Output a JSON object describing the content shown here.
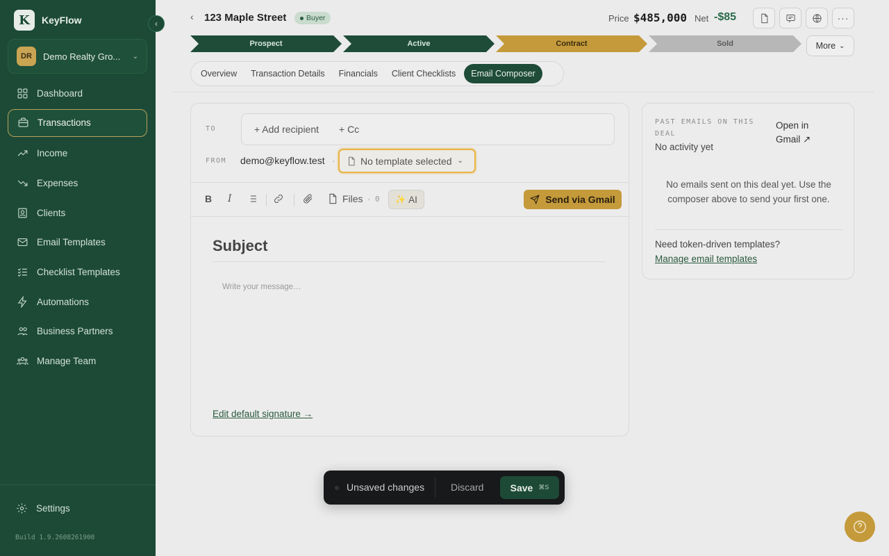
{
  "app": {
    "name": "KeyFlow",
    "logo_letter": "K"
  },
  "org": {
    "initials": "DR",
    "name": "Demo Realty Gro..."
  },
  "nav": {
    "items": [
      {
        "label": "Dashboard",
        "icon": "dashboard-icon"
      },
      {
        "label": "Transactions",
        "icon": "briefcase-icon",
        "active": true
      },
      {
        "label": "Income",
        "icon": "trend-up-icon"
      },
      {
        "label": "Expenses",
        "icon": "trend-down-icon"
      },
      {
        "label": "Clients",
        "icon": "contacts-icon"
      },
      {
        "label": "Email Templates",
        "icon": "mail-icon"
      },
      {
        "label": "Checklist Templates",
        "icon": "checklist-icon"
      },
      {
        "label": "Automations",
        "icon": "bolt-icon"
      },
      {
        "label": "Business Partners",
        "icon": "partners-icon"
      },
      {
        "label": "Manage Team",
        "icon": "team-icon"
      }
    ],
    "settings_label": "Settings",
    "build": "Build 1.9.2608261900"
  },
  "header": {
    "title": "123 Maple Street",
    "badge": "Buyer",
    "price_label": "Price",
    "price_value": "$485,000",
    "net_label": "Net",
    "net_value": "-$85"
  },
  "stages": {
    "items": [
      {
        "label": "Prospect",
        "state": "done"
      },
      {
        "label": "Active",
        "state": "done"
      },
      {
        "label": "Contract",
        "state": "current"
      },
      {
        "label": "Sold",
        "state": "pending"
      }
    ],
    "more_label": "More"
  },
  "tabs": [
    {
      "label": "Overview"
    },
    {
      "label": "Transaction Details"
    },
    {
      "label": "Financials"
    },
    {
      "label": "Client Checklists"
    },
    {
      "label": "Email Composer",
      "active": true
    }
  ],
  "composer": {
    "to_label": "TO",
    "add_recipient": "+ Add recipient",
    "add_cc": "+ Cc",
    "from_label": "FROM",
    "from_email": "demo@keyflow.test",
    "template_select": "No template selected",
    "toolbar": {
      "bold": "B",
      "italic": "I",
      "files_label": "Files",
      "files_count": "0",
      "ai_label": "AI",
      "send_label": "Send via Gmail"
    },
    "subject_placeholder": "Subject",
    "message_placeholder": "Write your message…",
    "signature_link": "Edit default signature →"
  },
  "past_emails": {
    "label": "PAST EMAILS ON THIS DEAL",
    "status": "No activity yet",
    "open_gmail": "Open in Gmail ↗",
    "empty_message": "No emails sent on this deal yet. Use the composer above to send your first one.",
    "need_templates": "Need token-driven templates?",
    "manage_link": "Manage email templates"
  },
  "savebar": {
    "unsaved": "Unsaved changes",
    "discard": "Discard",
    "save": "Save",
    "shortcut": "⌘S"
  },
  "colors": {
    "sidebar": "#1c4a36",
    "accent_gold": "#c49a3b",
    "stage_done": "#1e4c38",
    "stage_current": "#c49a3b",
    "stage_pending": "#b7b7b7"
  }
}
